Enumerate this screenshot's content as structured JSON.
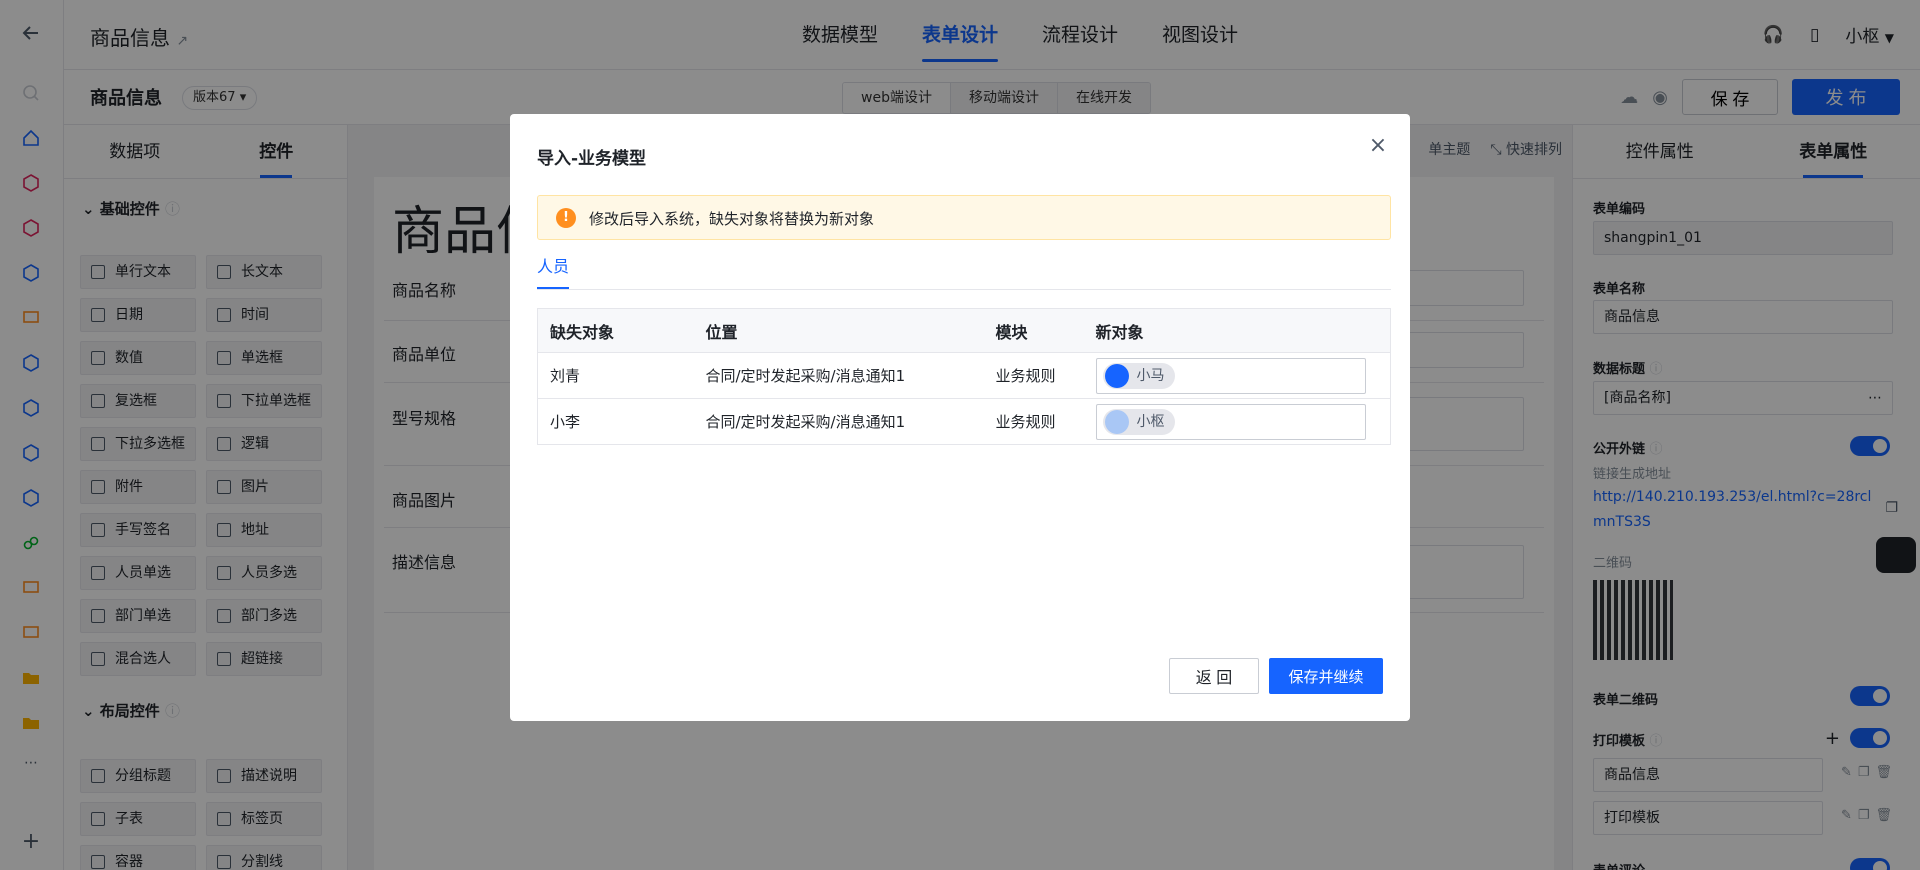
{
  "app": {
    "title": "商品信息",
    "top_nav": [
      "数据模型",
      "表单设计",
      "流程设计",
      "视图设计"
    ],
    "user": "小枢"
  },
  "subbar": {
    "form_title": "商品信息",
    "version": "版本67",
    "segments": [
      "web端设计",
      "移动端设计",
      "在线开发"
    ],
    "save": "保 存",
    "publish": "发 布"
  },
  "left_panel": {
    "tabs": [
      "数据项",
      "控件"
    ],
    "group_basic": "基础控件",
    "group_layout": "布局控件",
    "basic_controls": [
      "单行文本",
      "长文本",
      "日期",
      "时间",
      "数值",
      "单选框",
      "复选框",
      "下拉单选框",
      "下拉多选框",
      "逻辑",
      "附件",
      "图片",
      "手写签名",
      "地址",
      "人员单选",
      "人员多选",
      "部门单选",
      "部门多选",
      "混合选人",
      "超链接"
    ],
    "layout_controls": [
      "分组标题",
      "描述说明",
      "子表",
      "标签页",
      "容器",
      "分割线"
    ]
  },
  "canvas": {
    "big_title": "商品信",
    "fields": [
      "商品名称",
      "商品单位",
      "型号规格",
      "商品图片",
      "描述信息"
    ],
    "tools": [
      "单主题",
      "快速排列"
    ]
  },
  "right_panel": {
    "tabs": [
      "控件属性",
      "表单属性"
    ],
    "form_code_label": "表单编码",
    "form_code": "shangpin1_01",
    "form_name_label": "表单名称",
    "form_name": "商品信息",
    "data_title_label": "数据标题",
    "data_title": "[商品名称]",
    "public_link_label": "公开外链",
    "link_gen": "链接生成地址",
    "link": "http://140.210.193.253/el.html?c=28rclmnTS3S",
    "qr_label": "二维码",
    "form_qr_label": "表单二维码",
    "print_label": "打印模板",
    "print_items": [
      "商品信息",
      "打印模板"
    ],
    "comment_label": "表单评论"
  },
  "modal": {
    "title": "导入-业务模型",
    "alert": "修改后导入系统，缺失对象将替换为新对象",
    "tab": "人员",
    "columns": [
      "缺失对象",
      "位置",
      "模块",
      "新对象"
    ],
    "rows": [
      {
        "missing": "刘青",
        "location": "合同/定时发起采购/消息通知1",
        "module": "业务规则",
        "new": "小马"
      },
      {
        "missing": "小李",
        "location": "合同/定时发起采购/消息通知1",
        "module": "业务规则",
        "new": "小枢"
      }
    ],
    "back": "返 回",
    "save_continue": "保存并继续"
  },
  "colors": {
    "primary": "#1664ff",
    "warning": "#ff8f1f",
    "mask": "rgba(0,0,0,0.45)"
  }
}
